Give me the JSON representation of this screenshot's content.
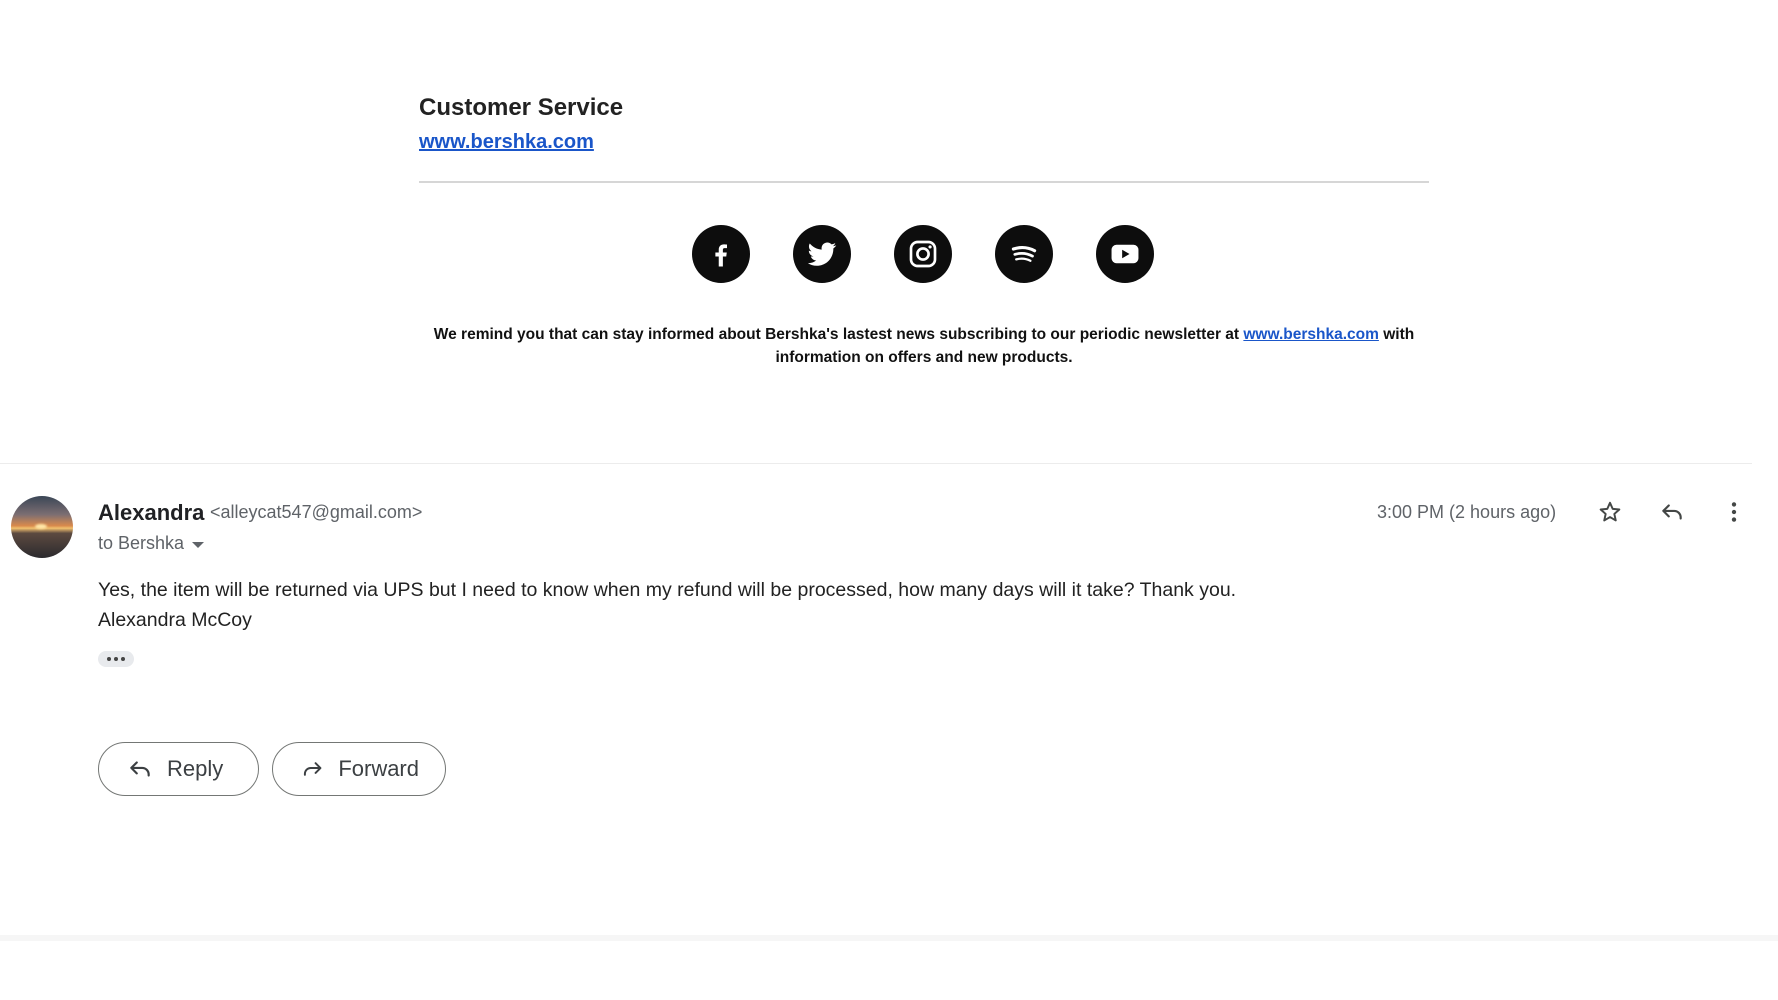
{
  "signature": {
    "title": "Customer Service",
    "link": "www.bershka.com",
    "social": [
      "facebook-icon",
      "twitter-icon",
      "instagram-icon",
      "spotify-icon",
      "youtube-icon"
    ],
    "reminder_before": "We remind you that can stay informed about Bershka's lastest news subscribing to our periodic newsletter at",
    "reminder_link": "www.bershka.com",
    "reminder_after": "with information on offers and new products."
  },
  "message": {
    "sender_name": "Alexandra",
    "sender_email": "<alleycat547@gmail.com>",
    "to": "to Bershka",
    "timestamp": "3:00 PM (2 hours ago)",
    "body_line1": "Yes, the item will be returned via UPS but I need to know when my refund will be processed, how many days will it take? Thank you.",
    "body_line2": "Alexandra McCoy"
  },
  "actions": {
    "reply": "Reply",
    "forward": "Forward"
  },
  "colors": {
    "link": "#1a56c9",
    "text": "#202124",
    "muted": "#5f6368"
  }
}
